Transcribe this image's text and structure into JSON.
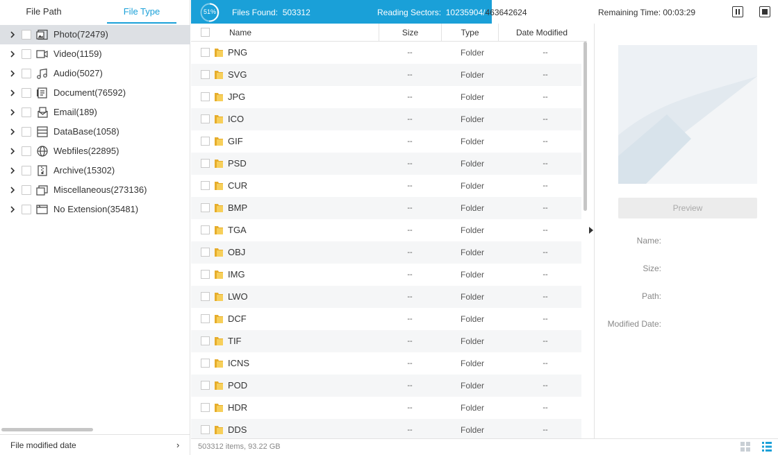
{
  "colors": {
    "accent": "#1aa0d8",
    "selected_row": "#dde0e4",
    "folder": "#f3c44b"
  },
  "tabs": {
    "file_path": "File Path",
    "file_type": "File Type",
    "active": "File Type"
  },
  "scan": {
    "percent_label": "51%",
    "percent": 51,
    "files_found_label": "Files Found:",
    "files_found_value": "503312",
    "sectors_label": "Reading Sectors:",
    "sectors_read": "10235904/",
    "sectors_total": "463642624",
    "remaining_label": "Remaining Time: 00:03:29"
  },
  "tree": [
    {
      "label": "Photo(72479)",
      "icon": "photo-icon",
      "selected": true
    },
    {
      "label": "Video(1159)",
      "icon": "video-icon"
    },
    {
      "label": "Audio(5027)",
      "icon": "audio-icon"
    },
    {
      "label": "Document(76592)",
      "icon": "document-icon"
    },
    {
      "label": "Email(189)",
      "icon": "email-icon"
    },
    {
      "label": "DataBase(1058)",
      "icon": "database-icon"
    },
    {
      "label": "Webfiles(22895)",
      "icon": "globe-icon"
    },
    {
      "label": "Archive(15302)",
      "icon": "archive-icon"
    },
    {
      "label": "Miscellaneous(273136)",
      "icon": "misc-icon"
    },
    {
      "label": "No Extension(35481)",
      "icon": "no-extension-icon"
    }
  ],
  "filter": {
    "label": "File modified date"
  },
  "table": {
    "columns": {
      "name": "Name",
      "size": "Size",
      "type": "Type",
      "date": "Date Modified"
    },
    "rows": [
      {
        "name": "PNG",
        "size": "--",
        "type": "Folder",
        "date": "--"
      },
      {
        "name": "SVG",
        "size": "--",
        "type": "Folder",
        "date": "--"
      },
      {
        "name": "JPG",
        "size": "--",
        "type": "Folder",
        "date": "--"
      },
      {
        "name": "ICO",
        "size": "--",
        "type": "Folder",
        "date": "--"
      },
      {
        "name": "GIF",
        "size": "--",
        "type": "Folder",
        "date": "--"
      },
      {
        "name": "PSD",
        "size": "--",
        "type": "Folder",
        "date": "--"
      },
      {
        "name": "CUR",
        "size": "--",
        "type": "Folder",
        "date": "--"
      },
      {
        "name": "BMP",
        "size": "--",
        "type": "Folder",
        "date": "--"
      },
      {
        "name": "TGA",
        "size": "--",
        "type": "Folder",
        "date": "--"
      },
      {
        "name": "OBJ",
        "size": "--",
        "type": "Folder",
        "date": "--"
      },
      {
        "name": "IMG",
        "size": "--",
        "type": "Folder",
        "date": "--"
      },
      {
        "name": "LWO",
        "size": "--",
        "type": "Folder",
        "date": "--"
      },
      {
        "name": "DCF",
        "size": "--",
        "type": "Folder",
        "date": "--"
      },
      {
        "name": "TIF",
        "size": "--",
        "type": "Folder",
        "date": "--"
      },
      {
        "name": "ICNS",
        "size": "--",
        "type": "Folder",
        "date": "--"
      },
      {
        "name": "POD",
        "size": "--",
        "type": "Folder",
        "date": "--"
      },
      {
        "name": "HDR",
        "size": "--",
        "type": "Folder",
        "date": "--"
      },
      {
        "name": "DDS",
        "size": "--",
        "type": "Folder",
        "date": "--"
      }
    ]
  },
  "preview": {
    "button": "Preview",
    "name_label": "Name:",
    "size_label": "Size:",
    "path_label": "Path:",
    "modified_label": "Modified Date:"
  },
  "status": {
    "summary": "503312 items, 93.22  GB"
  }
}
